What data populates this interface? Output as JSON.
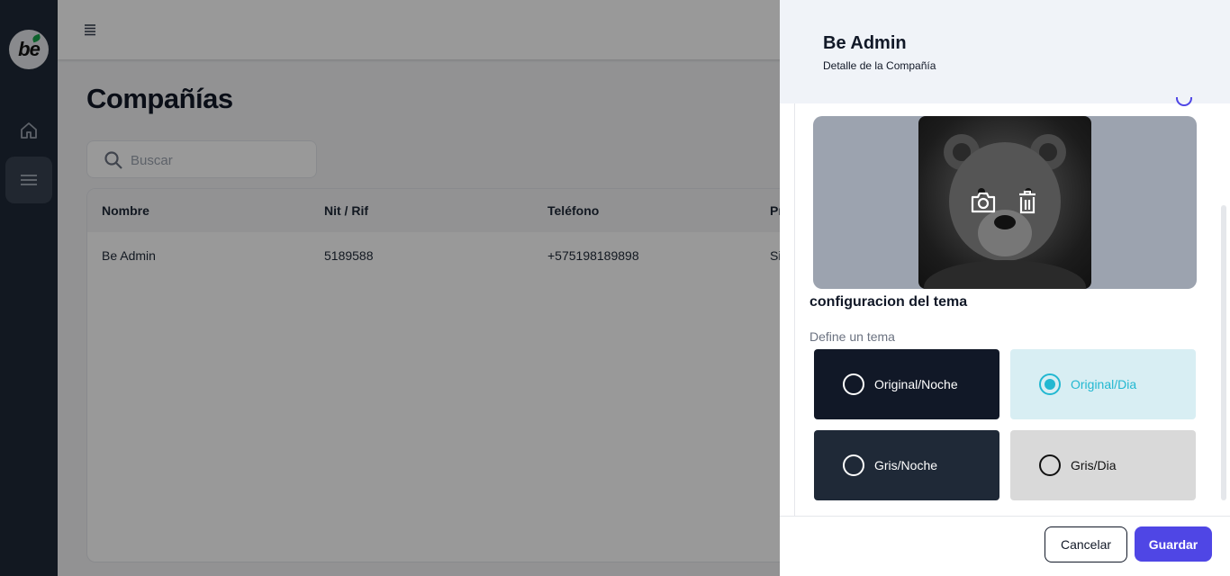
{
  "sidebar": {
    "logo_text": "be",
    "items": [
      {
        "icon": "home-icon"
      },
      {
        "icon": "menu-icon"
      }
    ]
  },
  "topbar": {
    "menu_icon": "hamburger-icon"
  },
  "main": {
    "title": "Compañías",
    "search": {
      "placeholder": "Buscar",
      "value": ""
    },
    "table": {
      "columns": [
        "Nombre",
        "Nit / Rif",
        "Teléfono",
        "Pr"
      ],
      "rows": [
        [
          "Be Admin",
          "5189588",
          "+575198189898",
          "Si"
        ]
      ]
    }
  },
  "drawer": {
    "title": "Be Admin",
    "subtitle": "Detalle de la Compañía",
    "image_actions": [
      "camera-icon",
      "trash-icon"
    ],
    "theme_section_title": "configuracion del tema",
    "theme_label": "Define un tema",
    "themes": [
      {
        "label": "Original/Noche",
        "selected": false
      },
      {
        "label": "Original/Dia",
        "selected": true
      },
      {
        "label": "Gris/Noche",
        "selected": false
      },
      {
        "label": "Gris/Dia",
        "selected": false
      }
    ],
    "cancel_label": "Cancelar",
    "save_label": "Guardar"
  },
  "colors": {
    "sidebar": "#1f2937",
    "accent": "#4f46e5",
    "selected_theme": "#22b8d1"
  }
}
